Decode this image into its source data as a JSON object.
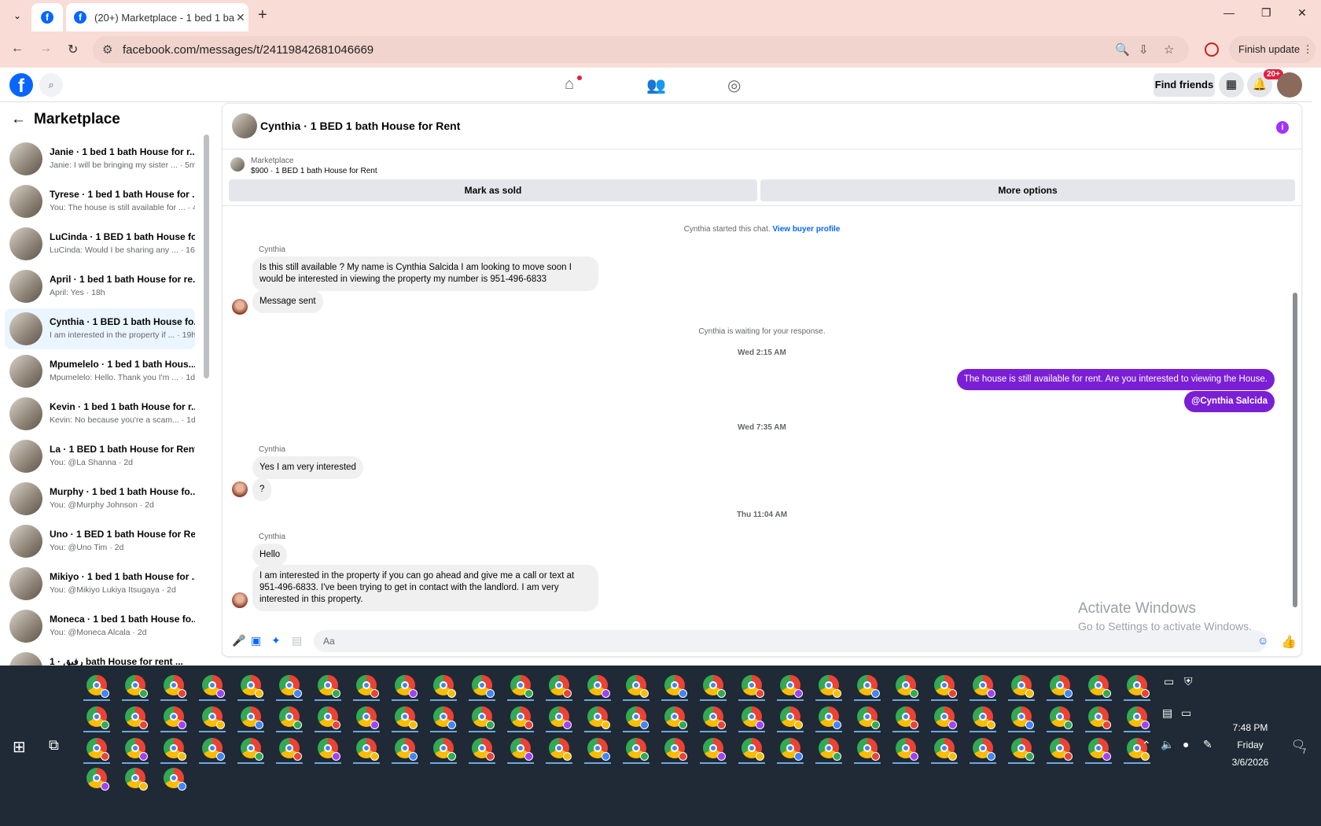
{
  "browser": {
    "tab_title": "(20+) Marketplace - 1 bed 1 ba",
    "url": "facebook.com/messages/t/24119842681046669",
    "finish_update": "Finish update"
  },
  "fb": {
    "find_friends": "Find friends",
    "notif_badge": "20+"
  },
  "sidebar": {
    "title": "Marketplace",
    "conversations": [
      {
        "name": "Janie · 1 bed 1 bath House for r...",
        "preview": "Janie: I will be bringing my sister ... · 5m"
      },
      {
        "name": "Tyrese · 1 bed 1 bath House for ...",
        "preview": "You: The house is still available for ... · 4h"
      },
      {
        "name": "LuCinda · 1 BED 1 bath House fo...",
        "preview": "LuCinda: Would I be sharing any ... · 16h"
      },
      {
        "name": "April · 1 bed 1 bath House for re...",
        "preview": "April: Yes · 18h"
      },
      {
        "name": "Cynthia · 1 BED 1 bath House fo...",
        "preview": "I am interested in the property if ... · 19h"
      },
      {
        "name": "Mpumelelo · 1 bed 1 bath Hous...",
        "preview": "Mpumelelo: Hello. Thank you I'm ... · 1d"
      },
      {
        "name": "Kevin · 1 bed 1 bath House for r...",
        "preview": "Kevin: No because you're a scam... · 1d"
      },
      {
        "name": "La · 1 BED 1 bath House for Rent",
        "preview": "You: @La Shanna · 2d"
      },
      {
        "name": "Murphy · 1 bed 1 bath House fo...",
        "preview": "You: @Murphy Johnson · 2d"
      },
      {
        "name": "Uno · 1 BED 1 bath House for Re...",
        "preview": "You: @Uno Tim · 2d"
      },
      {
        "name": "Mikiyo · 1 bed 1 bath House for ...",
        "preview": "You: @Mikiyo Lukiya Itsugaya · 2d"
      },
      {
        "name": "Moneca · 1 bed 1 bath House fo...",
        "preview": "You: @Moneca Alcala · 2d"
      },
      {
        "name": "رفيق · 1 bath House for rent ...",
        "preview": ""
      }
    ]
  },
  "chat": {
    "title": "Cynthia · 1 BED 1 bath House for Rent",
    "listing_source": "Marketplace",
    "listing_title": "$900 · 1 BED 1 bath House for Rent",
    "mark_sold": "Mark as sold",
    "more_options": "More options",
    "started": "Cynthia started this chat.",
    "view_buyer": "View buyer profile",
    "sender": "Cynthia",
    "msg1": "Is this still available ? My name is Cynthia Salcida I am looking to move soon I would be interested in viewing the property my number is 951-496-6833",
    "msg2": "Message sent",
    "waiting": "Cynthia is waiting for your response.",
    "ts1": "Wed 2:15 AM",
    "out1": "The house is still available for rent. Are you interested to viewing  the House.",
    "out2": "@Cynthia Salcida",
    "ts2": "Wed 7:35 AM",
    "msg3": "Yes I am very interested",
    "msg4": "?",
    "ts3": "Thu 11:04 AM",
    "msg5": "Hello",
    "msg6": "I am interested in the property if you can go ahead and give me a call or text at 951-496-6833. I've been trying to get in contact with the landlord. I am very interested in this property.",
    "composer_placeholder": "Aa"
  },
  "windows": {
    "activate": "Activate Windows",
    "activate_sub": "Go to Settings to activate Windows."
  },
  "taskbar": {
    "time": "7:48 PM",
    "day": "Friday",
    "date": "3/6/2026",
    "notif_count": "7"
  }
}
